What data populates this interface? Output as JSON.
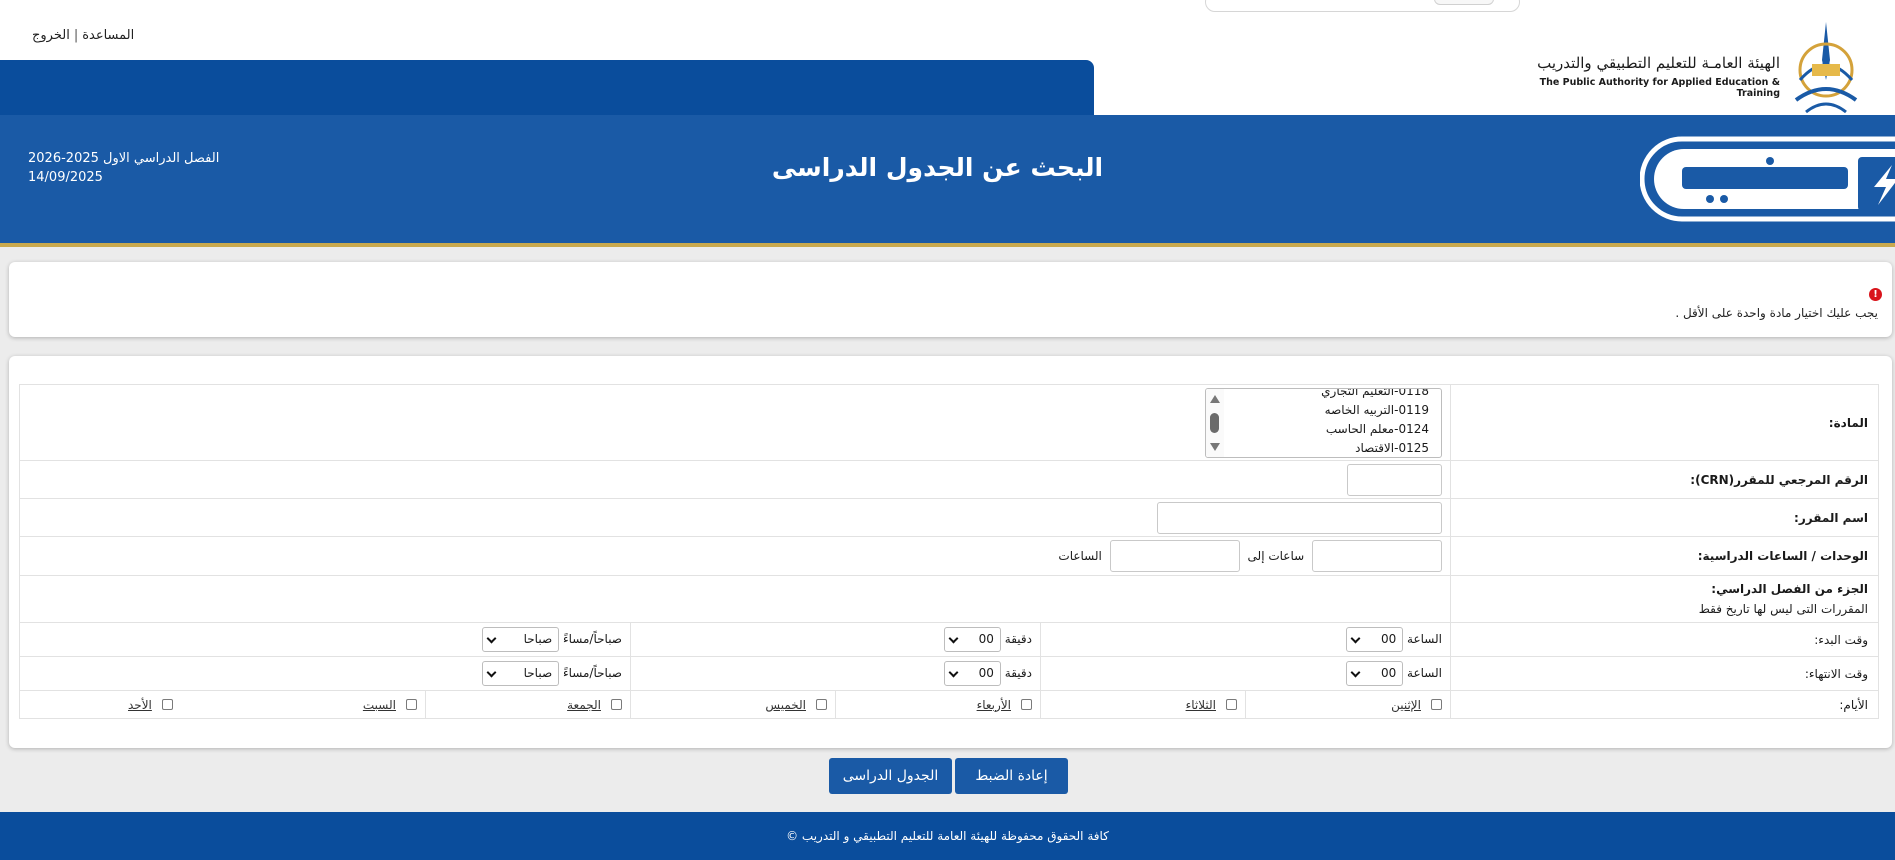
{
  "top_links": {
    "help": "المساعدة",
    "separator": "|",
    "logout": "الخروج"
  },
  "org": {
    "name_ar": "الهيئة العامـة  للتعليم التطبيقي والتدريب",
    "name_en": "The Public Authority for Applied Education & Training"
  },
  "header": {
    "title": "البحث عن الجدول الدراسى",
    "term": "الفصل الدراسي الاول 2025-2026",
    "date": "14/09/2025"
  },
  "alert": {
    "icon": "error-icon",
    "message": "يجب عليك اختيار مادة واحدة على الأقل ."
  },
  "form": {
    "subject_label": "المادة:",
    "subject_options": [
      "0118-التعليم التجاري",
      "0119-التربيه الخاصه",
      "0124-معلم الحاسب",
      "0125-الاقتصاد"
    ],
    "crn_label": "الرقم المرجعي للمقرر(CRN):",
    "course_name_label": "اسم المقرر:",
    "credits_label": "الوحدات / الساعات الدراسية:",
    "credits_between": "ساعات إلى",
    "credits_suffix": "الساعات",
    "part_of_term_label": "الجزء من الفصل الدراسي:",
    "part_of_term_value": "المقررات التى ليس لها تاريخ فقط",
    "start_time_label": "وقت البدء:",
    "end_time_label": "وقت الانتهاء:",
    "hour_label": "الساعة",
    "minute_label": "دقيقة",
    "ampm_label": "صباحاً/مساءً",
    "hour_value": "00",
    "minute_value": "00",
    "ampm_value": "صباحا",
    "days_label": "الأيام:",
    "days": [
      "الإثنين",
      "الثلاثاء",
      "الأربعاء",
      "الخميس",
      "الجمعة",
      "السبت",
      "الأحد"
    ]
  },
  "buttons": {
    "reset": "إعادة الضبط",
    "schedule": "الجدول الدراسى"
  },
  "footer": {
    "copyright": "كافة الحقوق محفوظة للهيئة العامة للتعليم التطبيقي و التدريب ©"
  },
  "colors": {
    "primary_blue": "#1a5aa6",
    "dark_blue": "#0a4d9c",
    "gold": "#c9a94e",
    "error_red": "#d9141b"
  }
}
